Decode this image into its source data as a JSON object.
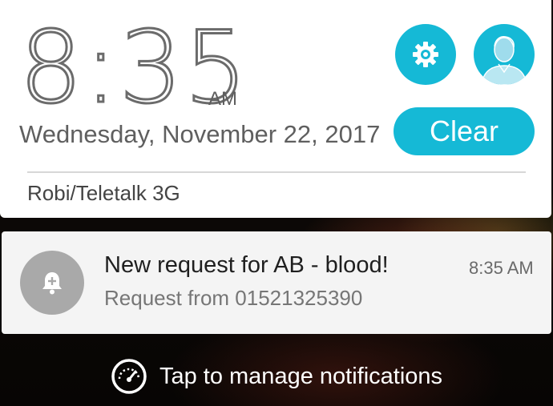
{
  "clock": {
    "time": "8:35",
    "ampm": "AM",
    "date": "Wednesday, November 22, 2017"
  },
  "quick_panel": {
    "settings_icon": "gear-icon",
    "avatar_icon": "user-avatar-icon",
    "clear_label": "Clear",
    "carrier": "Robi/Teletalk 3G",
    "accent_color": "#15b9d6"
  },
  "notification": {
    "icon": "bell-add-icon",
    "title": "New request for AB - blood!",
    "time": "8:35 AM",
    "text": "Request from 01521325390"
  },
  "footer": {
    "icon": "speedometer-icon",
    "label": "Tap to manage notifications"
  }
}
